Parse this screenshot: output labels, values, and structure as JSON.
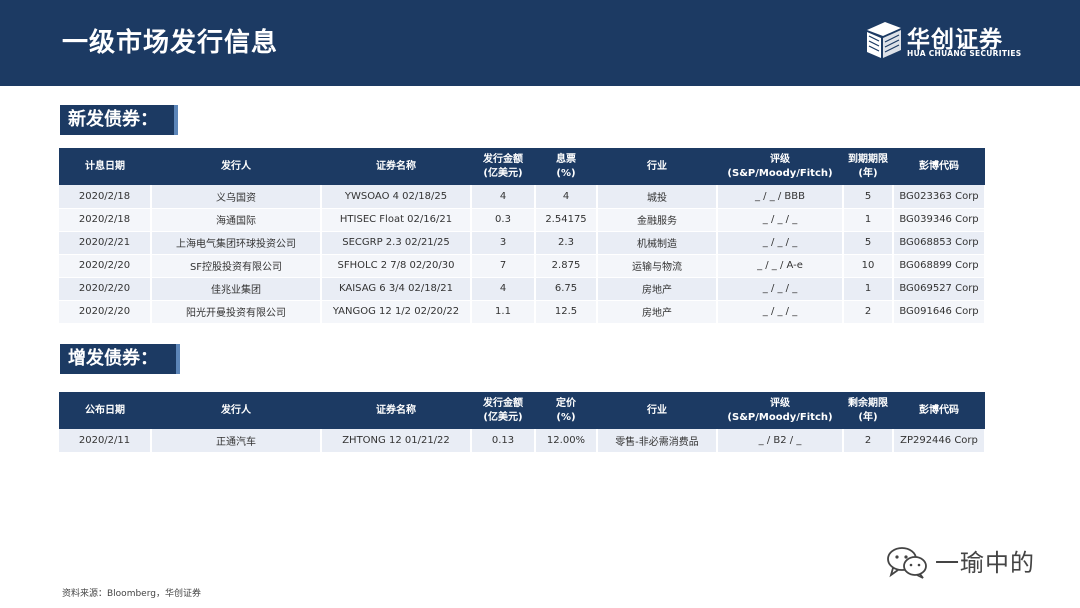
{
  "header": {
    "title": "一级市场发行信息",
    "logo_cn": "华创证券",
    "logo_en": "HUA CHUANG SECURITIES"
  },
  "new_bonds": {
    "label": "新发债券：",
    "columns": [
      "计息日期",
      "发行人",
      "证券名称",
      "发行金额\n(亿美元)",
      "息票\n(%)",
      "行业",
      "评级\n(S&P/Moody/Fitch)",
      "到期期限\n(年)",
      "彭博代码"
    ],
    "rows": [
      [
        "2020/2/18",
        "义乌国资",
        "YWSOAO 4 02/18/25",
        "4",
        "4",
        "城投",
        "_ / _ / BBB",
        "5",
        "BG023363 Corp"
      ],
      [
        "2020/2/18",
        "海通国际",
        "HTISEC Float 02/16/21",
        "0.3",
        "2.54175",
        "金融服务",
        "_ / _ / _",
        "1",
        "BG039346 Corp"
      ],
      [
        "2020/2/21",
        "上海电气集团环球投资公司",
        "SECGRP 2.3 02/21/25",
        "3",
        "2.3",
        "机械制造",
        "_ / _ / _",
        "5",
        "BG068853 Corp"
      ],
      [
        "2020/2/20",
        "SF控股投资有限公司",
        "SFHOLC 2 7/8 02/20/30",
        "7",
        "2.875",
        "运输与物流",
        "_ / _ / A-e",
        "10",
        "BG068899 Corp"
      ],
      [
        "2020/2/20",
        "佳兆业集团",
        "KAISAG 6 3/4 02/18/21",
        "4",
        "6.75",
        "房地产",
        "_ / _ / _",
        "1",
        "BG069527 Corp"
      ],
      [
        "2020/2/20",
        "阳光开曼投资有限公司",
        "YANGOG 12 1/2 02/20/22",
        "1.1",
        "12.5",
        "房地产",
        "_ / _ / _",
        "2",
        "BG091646 Corp"
      ]
    ]
  },
  "add_bonds": {
    "label": "增发债券：",
    "columns": [
      "公布日期",
      "发行人",
      "证券名称",
      "发行金额\n(亿美元)",
      "定价\n(%)",
      "行业",
      "评级\n(S&P/Moody/Fitch)",
      "剩余期限\n(年)",
      "彭博代码"
    ],
    "rows": [
      [
        "2020/2/11",
        "正通汽车",
        "ZHTONG 12 01/21/22",
        "0.13",
        "12.00%",
        "零售-非必需消费品",
        "_ / B2 / _",
        "2",
        "ZP292446 Corp"
      ]
    ]
  },
  "footer": {
    "source": "资料来源：Bloomberg，华创证券",
    "watermark": "一瑜中的"
  },
  "colors": {
    "header_navy": "#1c3a63",
    "row_light": "#e9edf5",
    "accent_blue": "#5c85b8"
  }
}
